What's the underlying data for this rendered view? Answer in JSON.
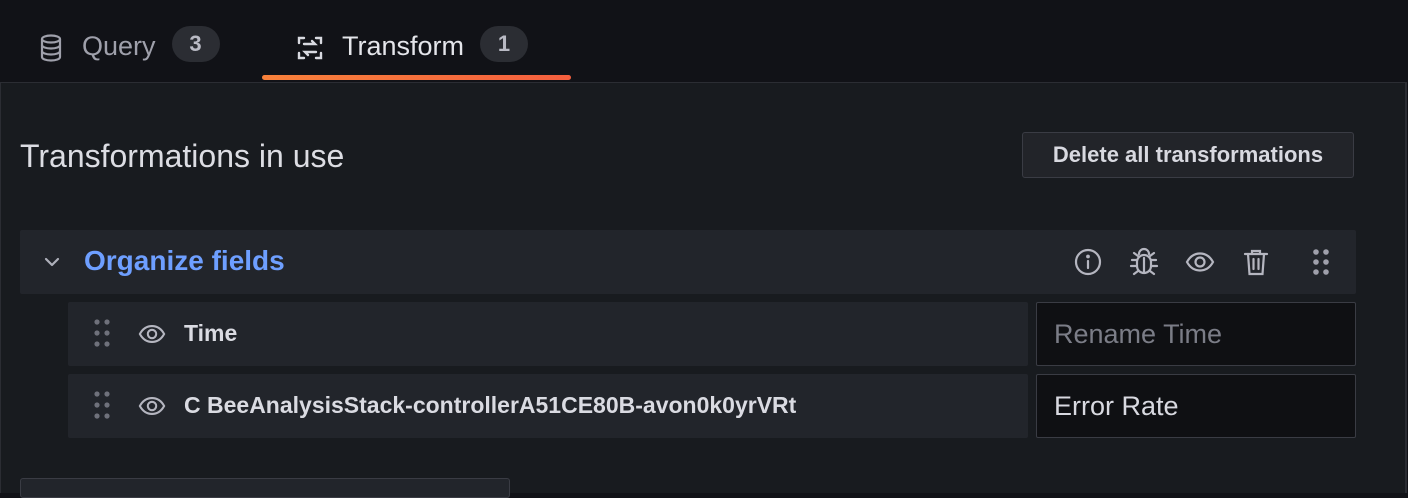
{
  "tabs": [
    {
      "label": "Query",
      "count": "3",
      "icon": "database-icon",
      "active": false
    },
    {
      "label": "Transform",
      "count": "1",
      "icon": "transform-icon",
      "active": true
    }
  ],
  "section": {
    "title": "Transformations in use",
    "delete_all_label": "Delete all transformations"
  },
  "transformation": {
    "title": "Organize fields",
    "header_icons": [
      "info-icon",
      "bug-icon",
      "eye-icon",
      "trash-icon",
      "drag-handle-icon"
    ],
    "fields": [
      {
        "name": "Time",
        "rename_value": "",
        "rename_placeholder": "Rename Time"
      },
      {
        "name": "C BeeAnalysisStack-controllerA51CE80B-avon0k0yrVRt",
        "rename_value": "Error Rate",
        "rename_placeholder": ""
      }
    ]
  },
  "colors": {
    "accent_link": "#6e9fff",
    "active_tab_underline": "#f55f3e",
    "background": "#111217",
    "panel": "#181b1f"
  }
}
